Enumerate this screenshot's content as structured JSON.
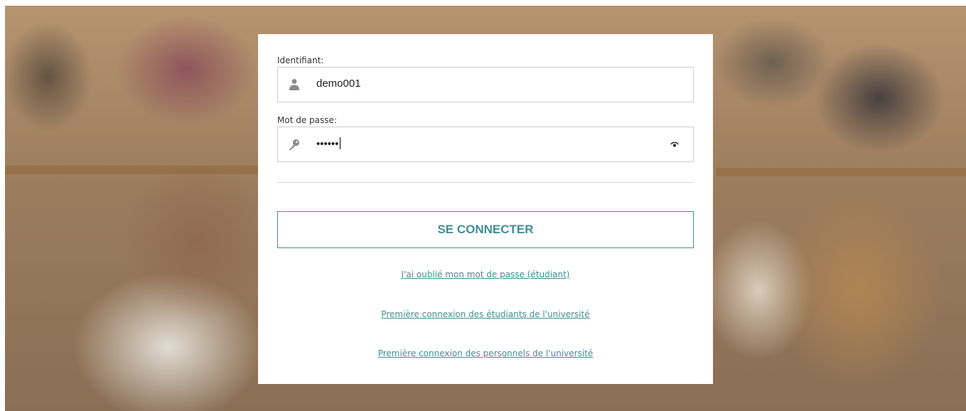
{
  "login": {
    "username_label": "Identifiant:",
    "username_value": "demo001",
    "password_label": "Mot de passe:",
    "password_masked": "••••••",
    "submit_label": "SE CONNECTER"
  },
  "links": {
    "forgot_password": "J'ai oublié mon mot de passe (étudiant)",
    "first_login_students": "Première connexion des étudiants de l'université",
    "first_login_staff": "Première connexion des personnels de l'université"
  },
  "icons": {
    "username": "user-icon",
    "password": "key-icon",
    "toggle": "eye-icon"
  },
  "colors": {
    "accent": "#3f8e95",
    "field_border": "#cccccc",
    "card_background": "#ffffff"
  }
}
